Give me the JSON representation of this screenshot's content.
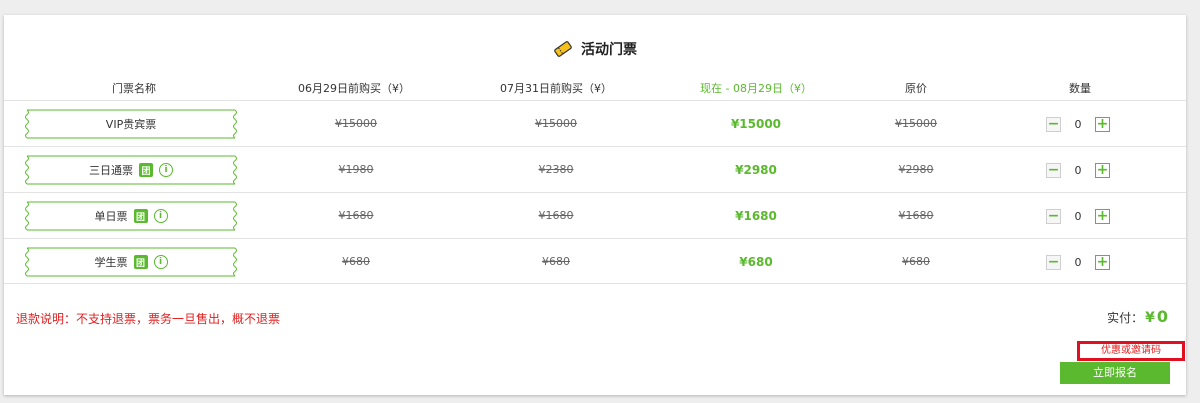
{
  "section": {
    "title": "活动门票",
    "icon": "ticket-icon"
  },
  "headers": {
    "name": "门票名称",
    "early1": "06月29日前购买（¥）",
    "early2": "07月31日前购买（¥）",
    "current": "现在 - 08月29日（¥）",
    "original": "原价",
    "quantity": "数量"
  },
  "tickets": [
    {
      "name": "VIP贵宾票",
      "tuan": false,
      "price1": "¥15000",
      "price2": "¥15000",
      "now": "¥15000",
      "orig": "¥15000",
      "qty": "0"
    },
    {
      "name": "三日通票",
      "tuan": true,
      "tuan_label": "团",
      "info_label": "i",
      "price1": "¥1980",
      "price2": "¥2380",
      "now": "¥2980",
      "orig": "¥2980",
      "qty": "0"
    },
    {
      "name": "单日票",
      "tuan": true,
      "tuan_label": "团",
      "info_label": "i",
      "price1": "¥1680",
      "price2": "¥1680",
      "now": "¥1680",
      "orig": "¥1680",
      "qty": "0"
    },
    {
      "name": "学生票",
      "tuan": true,
      "tuan_label": "团",
      "info_label": "i",
      "price1": "¥680",
      "price2": "¥680",
      "now": "¥680",
      "orig": "¥680",
      "qty": "0"
    }
  ],
  "qty_controls": {
    "minus": "−",
    "plus": "+"
  },
  "refund_note": "退款说明：不支持退票，票务一旦售出，概不退票",
  "total": {
    "label": "实付：",
    "currency": "¥",
    "amount": "0"
  },
  "coupon_link": "优惠或邀请码",
  "submit_label": "立即报名",
  "colors": {
    "accent": "#5ab92e",
    "warning": "#e02020"
  }
}
